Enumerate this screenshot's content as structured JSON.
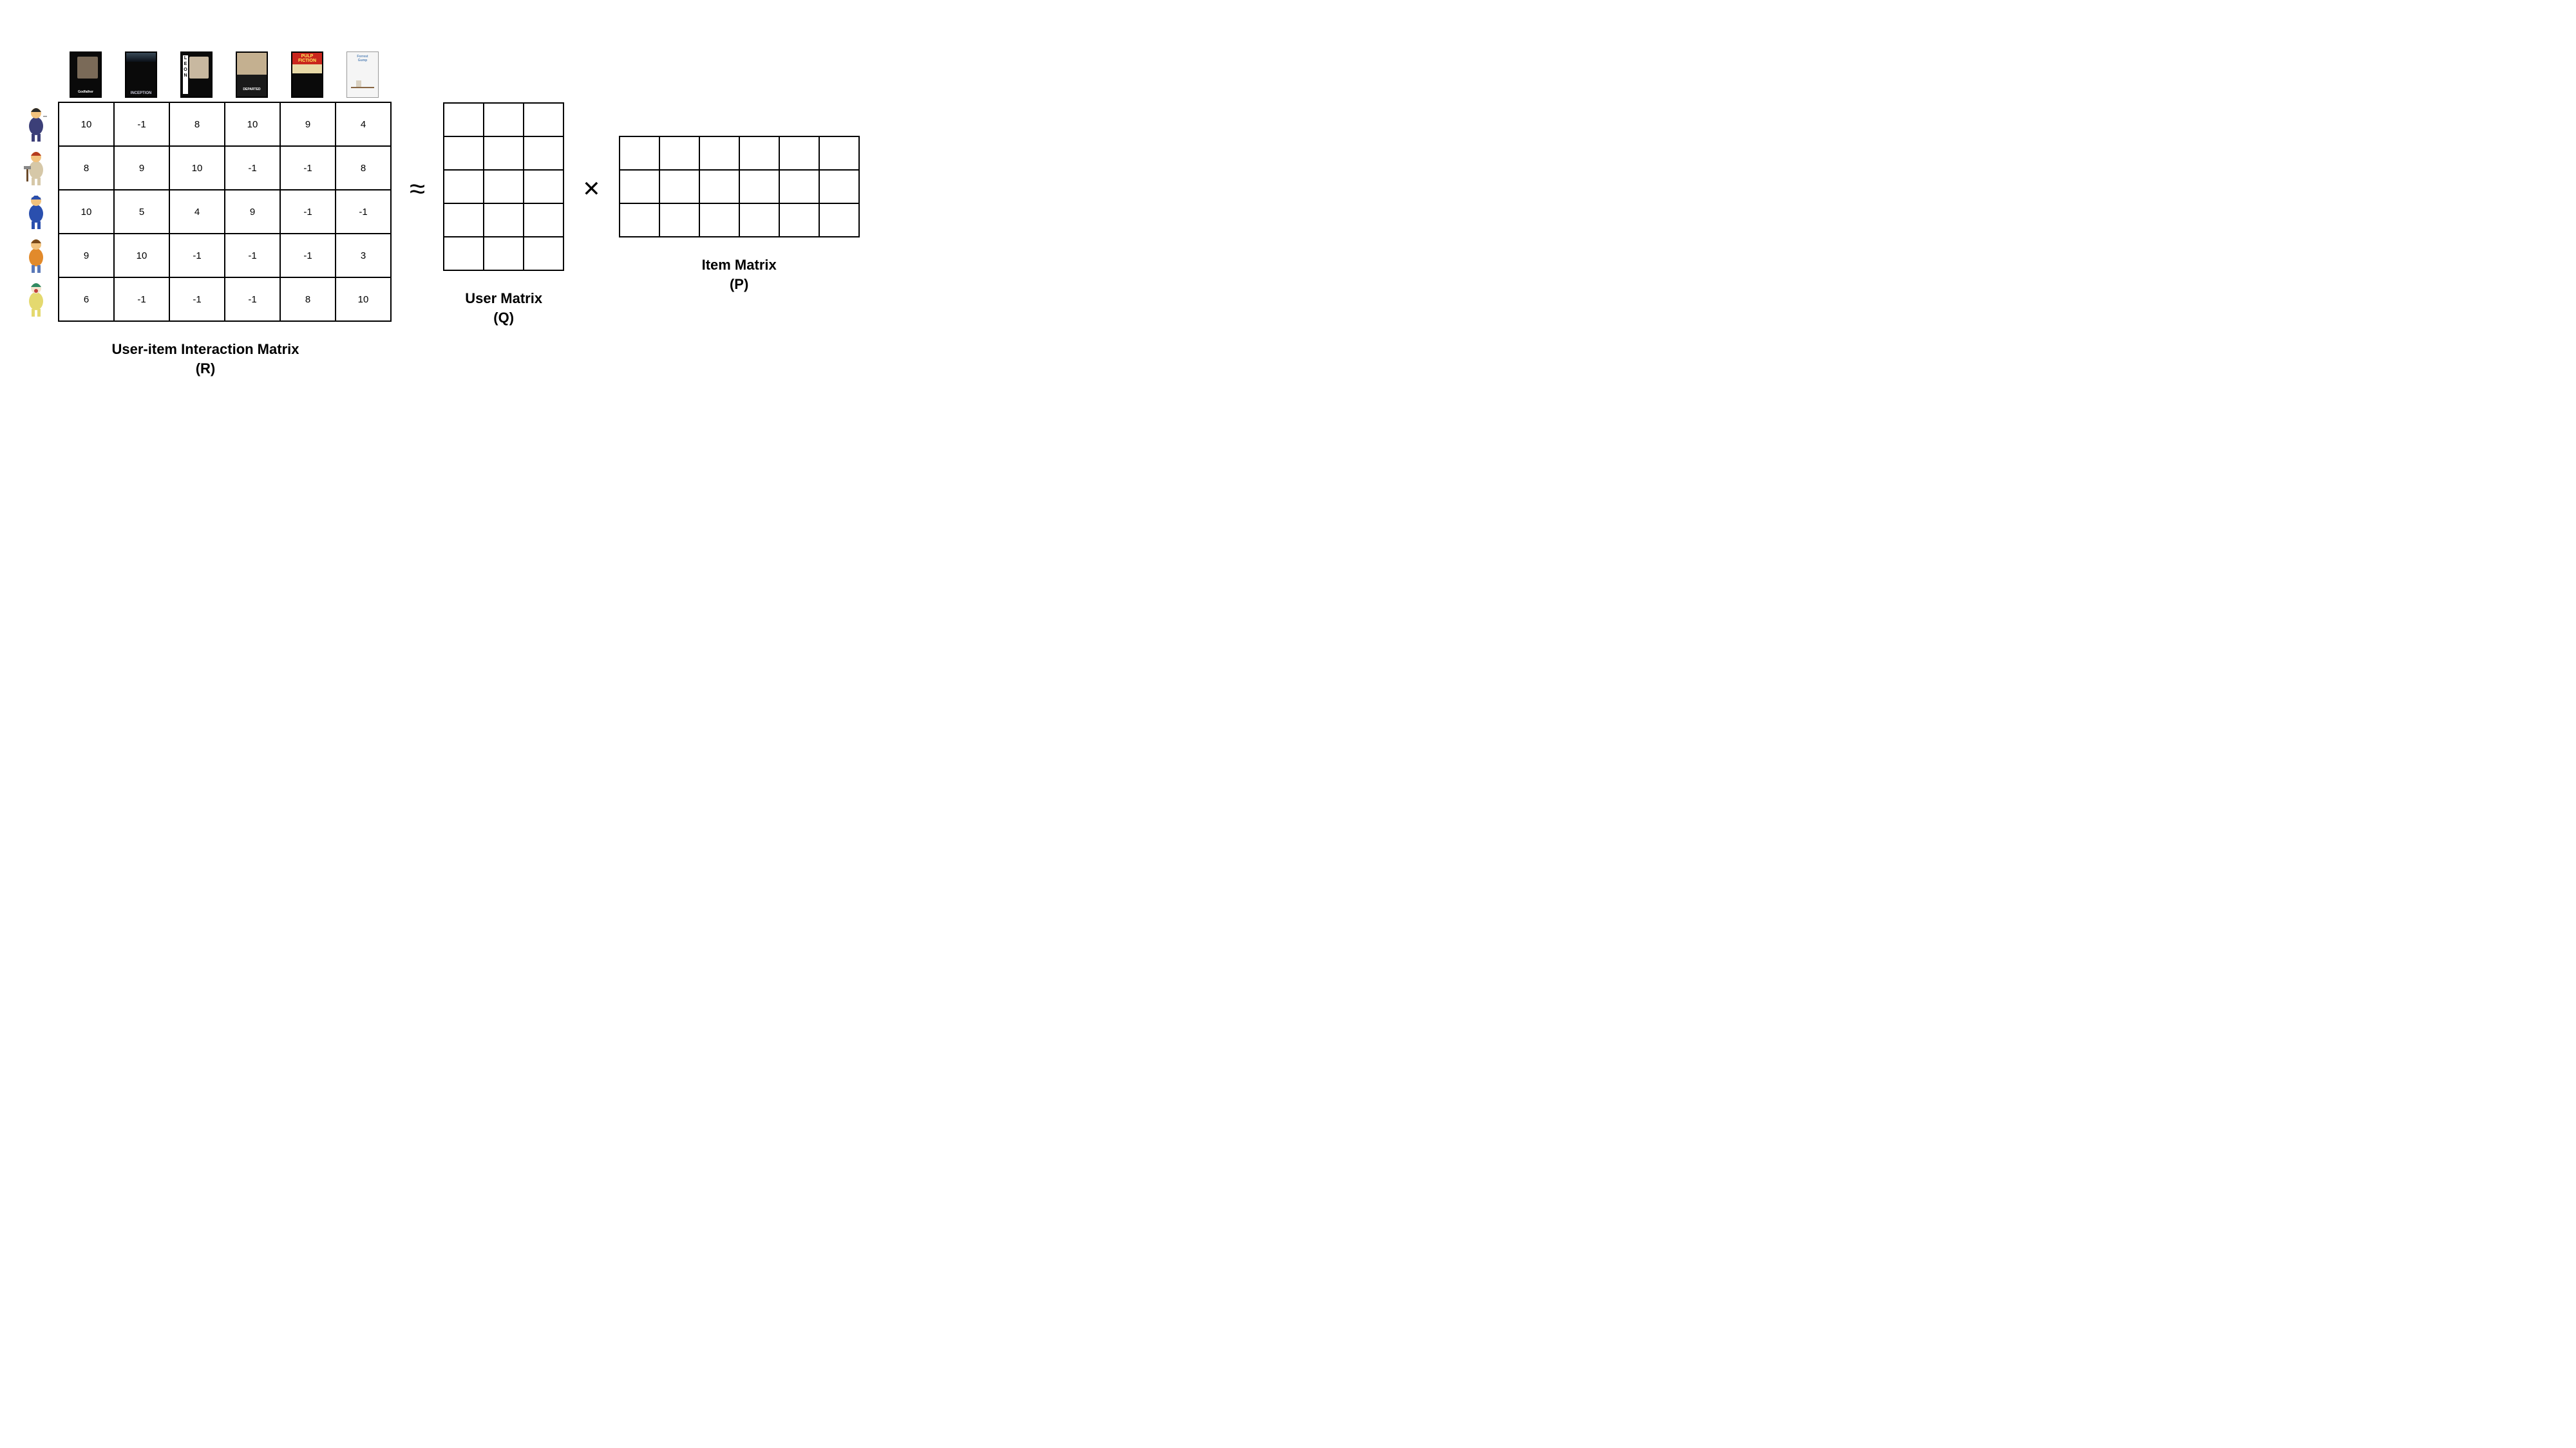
{
  "movies": [
    {
      "name": "godfather",
      "title_hint": "The Godfather",
      "style": "dark"
    },
    {
      "name": "inception",
      "title_hint": "Inception",
      "style": "dark"
    },
    {
      "name": "leon",
      "title_hint": "Leon",
      "style": "dark"
    },
    {
      "name": "departed",
      "title_hint": "The Departed",
      "style": "dark"
    },
    {
      "name": "pulp",
      "title_hint": "Pulp Fiction",
      "style": "dark"
    },
    {
      "name": "forrest",
      "title_hint": "Forrest Gump",
      "style": "white"
    }
  ],
  "users": [
    {
      "name": "fat-tony"
    },
    {
      "name": "willie"
    },
    {
      "name": "wiggum"
    },
    {
      "name": "nelson"
    },
    {
      "name": "krusty"
    }
  ],
  "R": {
    "rows": [
      [
        {
          "v": "10"
        },
        {
          "v": "-1"
        },
        {
          "v": "8"
        },
        {
          "v": "10"
        },
        {
          "v": "9"
        },
        {
          "v": "4"
        }
      ],
      [
        {
          "v": "8"
        },
        {
          "v": "9"
        },
        {
          "v": "10",
          "hl": "orange"
        },
        {
          "v": "-1"
        },
        {
          "v": "-1"
        },
        {
          "v": "8"
        }
      ],
      [
        {
          "v": "10"
        },
        {
          "v": "5"
        },
        {
          "v": "4"
        },
        {
          "v": "9"
        },
        {
          "v": "-1"
        },
        {
          "v": "-1"
        }
      ],
      [
        {
          "v": "9",
          "hl": "green"
        },
        {
          "v": "10"
        },
        {
          "v": "-1"
        },
        {
          "v": "-1"
        },
        {
          "v": "-1"
        },
        {
          "v": "3"
        }
      ],
      [
        {
          "v": "6"
        },
        {
          "v": "-1"
        },
        {
          "v": "-1"
        },
        {
          "v": "-1"
        },
        {
          "v": "8",
          "hl": "blue"
        },
        {
          "v": "10"
        }
      ]
    ]
  },
  "Q": {
    "rows": [
      [
        {},
        {},
        {}
      ],
      [
        {
          "hl": "orange"
        },
        {
          "hl": "orange"
        },
        {
          "hl": "orange"
        }
      ],
      [
        {},
        {},
        {}
      ],
      [
        {
          "hl": "green"
        },
        {
          "hl": "green"
        },
        {
          "hl": "green"
        }
      ],
      [
        {
          "hl": "blue"
        },
        {
          "hl": "blue"
        },
        {
          "hl": "blue"
        }
      ]
    ]
  },
  "P": {
    "rows": [
      [
        {
          "hl": "green"
        },
        {},
        {
          "hl": "orange"
        },
        {},
        {
          "hl": "blue"
        },
        {}
      ],
      [
        {
          "hl": "green"
        },
        {},
        {
          "hl": "orange"
        },
        {},
        {
          "hl": "blue"
        },
        {}
      ],
      [
        {
          "hl": "green"
        },
        {},
        {
          "hl": "orange"
        },
        {},
        {
          "hl": "blue"
        },
        {}
      ]
    ]
  },
  "labels": {
    "R1": "User-item Interaction Matrix",
    "R2": "(R)",
    "Q1": "User Matrix",
    "Q2": "(Q)",
    "P1": "Item Matrix",
    "P2": "(P)",
    "approx": "≈",
    "times": "✕"
  },
  "colors": {
    "orange": "#f2b999",
    "green": "#a7d18c",
    "blue": "#a8c9e6"
  },
  "chart_data": {
    "type": "table",
    "description": "Matrix factorization diagram: R ≈ Q × P",
    "R_matrix": [
      [
        10,
        -1,
        8,
        10,
        9,
        4
      ],
      [
        8,
        9,
        10,
        -1,
        -1,
        8
      ],
      [
        10,
        5,
        4,
        9,
        -1,
        -1
      ],
      [
        9,
        10,
        -1,
        -1,
        -1,
        3
      ],
      [
        6,
        -1,
        -1,
        -1,
        8,
        10
      ]
    ],
    "R_highlights": [
      {
        "row": 1,
        "col": 2,
        "color": "orange"
      },
      {
        "row": 3,
        "col": 0,
        "color": "green"
      },
      {
        "row": 4,
        "col": 4,
        "color": "blue"
      }
    ],
    "Q_shape": {
      "rows": 5,
      "cols": 3
    },
    "Q_row_highlights": [
      {
        "row": 1,
        "color": "orange"
      },
      {
        "row": 3,
        "color": "green"
      },
      {
        "row": 4,
        "color": "blue"
      }
    ],
    "P_shape": {
      "rows": 3,
      "cols": 6
    },
    "P_col_highlights": [
      {
        "col": 0,
        "color": "green"
      },
      {
        "col": 2,
        "color": "orange"
      },
      {
        "col": 4,
        "color": "blue"
      }
    ],
    "row_labels_users": [
      "fat-tony",
      "willie",
      "wiggum",
      "nelson",
      "krusty"
    ],
    "col_labels_movies": [
      "The Godfather",
      "Inception",
      "Leon",
      "The Departed",
      "Pulp Fiction",
      "Forrest Gump"
    ]
  }
}
